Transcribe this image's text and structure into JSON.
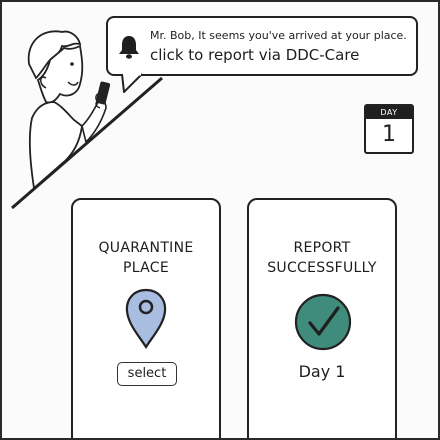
{
  "notification": {
    "message": "Mr. Bob, It seems you've arrived at your place.",
    "action": "click to report via DDC-Care"
  },
  "calendar": {
    "label": "DAY",
    "number": "1"
  },
  "cards": {
    "quarantine": {
      "title_line1": "QUARANTINE",
      "title_line2": "PLACE",
      "button_label": "select"
    },
    "report": {
      "title_line1": "REPORT",
      "title_line2": "SUCCESSFULLY",
      "day_label": "Day 1"
    }
  },
  "colors": {
    "pin_fill": "#a9bde0",
    "check_fill": "#3f8c7c",
    "outline": "#222222"
  }
}
